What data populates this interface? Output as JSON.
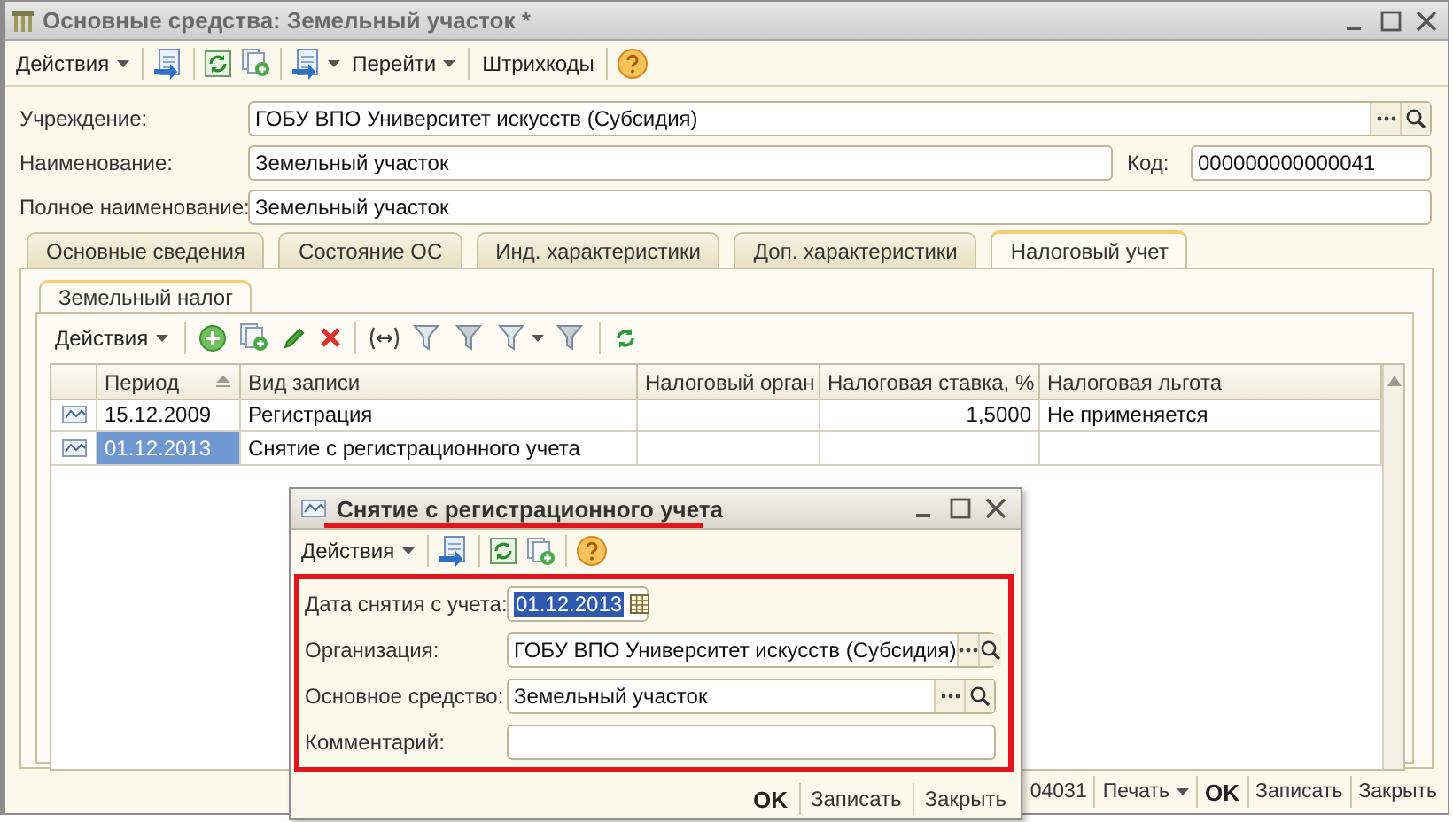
{
  "window": {
    "title": "Основные средства: Земельный участок *"
  },
  "toolbar": {
    "actions": "Действия",
    "goto": "Перейти",
    "barcodes": "Штрихкоды"
  },
  "fields": [
    {
      "kind": "select",
      "label": "Учреждение:",
      "value": "ГОБУ ВПО Университет искусств (Субсидия)"
    },
    {
      "kind": "text",
      "label": "Наименование:",
      "value": "Земельный участок",
      "code_label": "Код:",
      "code_value": "000000000000041"
    },
    {
      "kind": "text",
      "label": "Полное наименование:",
      "value": "Земельный участок"
    }
  ],
  "tabs": [
    {
      "label": "Основные сведения",
      "selected": false
    },
    {
      "label": "Состояние ОС",
      "selected": false
    },
    {
      "label": "Инд. характеристики",
      "selected": false
    },
    {
      "label": "Доп. характеристики",
      "selected": false
    },
    {
      "label": "Налоговый учет",
      "selected": true
    }
  ],
  "subtabs": [
    {
      "label": "Земельный налог",
      "selected": true
    }
  ],
  "table_toolbar": {
    "actions": "Действия"
  },
  "table": {
    "columns": [
      "Период",
      "Вид записи",
      "Налоговый орган",
      "Налоговая ставка, %",
      "Налоговая льгота"
    ],
    "rows": [
      {
        "period": "15.12.2009",
        "record_type": "Регистрация",
        "rate": "1,5000",
        "benefit": "Не применяется",
        "selected": false
      },
      {
        "period": "01.12.2013",
        "record_type": "Снятие с регистрационного учета",
        "selected": true
      }
    ]
  },
  "bottom_bar": {
    "ref": "04031",
    "print": "Печать",
    "buttons": [
      {
        "label": "OK",
        "default": true
      },
      {
        "label": "Записать",
        "default": false
      },
      {
        "label": "Закрыть",
        "default": false
      }
    ]
  },
  "dialog": {
    "title": "Снятие с регистрационного учета",
    "toolbar": {
      "actions": "Действия"
    },
    "fields": [
      {
        "kind": "date",
        "label": "Дата снятия с учета:",
        "value": "01.12.2013",
        "text_selected": true
      },
      {
        "kind": "select",
        "label": "Организация:",
        "value": "ГОБУ ВПО Университет искусств (Субсидия)"
      },
      {
        "kind": "select",
        "label": "Основное средство:",
        "value": "Земельный участок"
      },
      {
        "kind": "text",
        "label": "Комментарий:"
      }
    ],
    "buttons": [
      {
        "label": "OK",
        "default": true
      },
      {
        "label": "Записать",
        "default": false
      },
      {
        "label": "Закрыть",
        "default": false
      }
    ]
  }
}
